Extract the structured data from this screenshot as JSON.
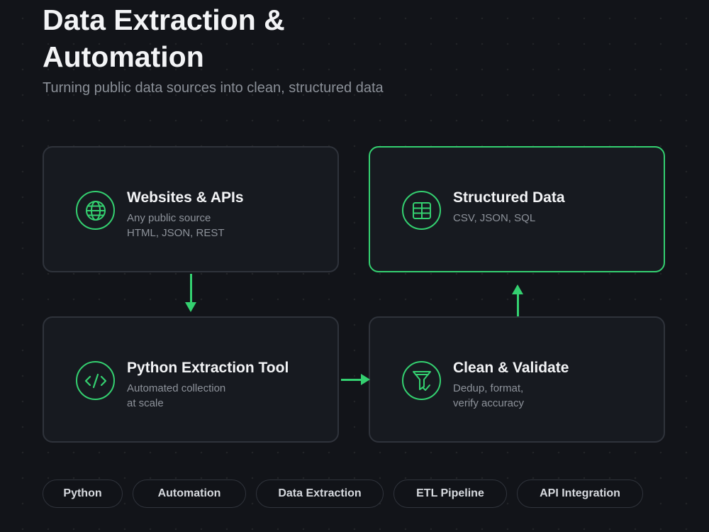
{
  "header": {
    "title": "Data Extraction & Automation",
    "subtitle": "Turning public data sources into clean, structured data"
  },
  "cards": {
    "websites": {
      "title": "Websites & APIs",
      "line1": "Any public source",
      "line2": "HTML, JSON, REST",
      "icon": "globe-icon"
    },
    "structured": {
      "title": "Structured Data",
      "line1": "CSV, JSON, SQL",
      "icon": "table-icon"
    },
    "python": {
      "title": "Python Extraction Tool",
      "line1": "Automated collection",
      "line2": "at scale",
      "icon": "code-icon"
    },
    "clean": {
      "title": "Clean & Validate",
      "line1": "Dedup, format,",
      "line2": "verify accuracy",
      "icon": "filter-icon"
    }
  },
  "tags": [
    "Python",
    "Automation",
    "Data Extraction",
    "ETL Pipeline",
    "API Integration"
  ],
  "colors": {
    "accent": "#34d070",
    "background": "#121419",
    "card": "#171a20",
    "card_border": "#2f333b",
    "text": "#f3f4f6",
    "muted": "#8d929a"
  }
}
